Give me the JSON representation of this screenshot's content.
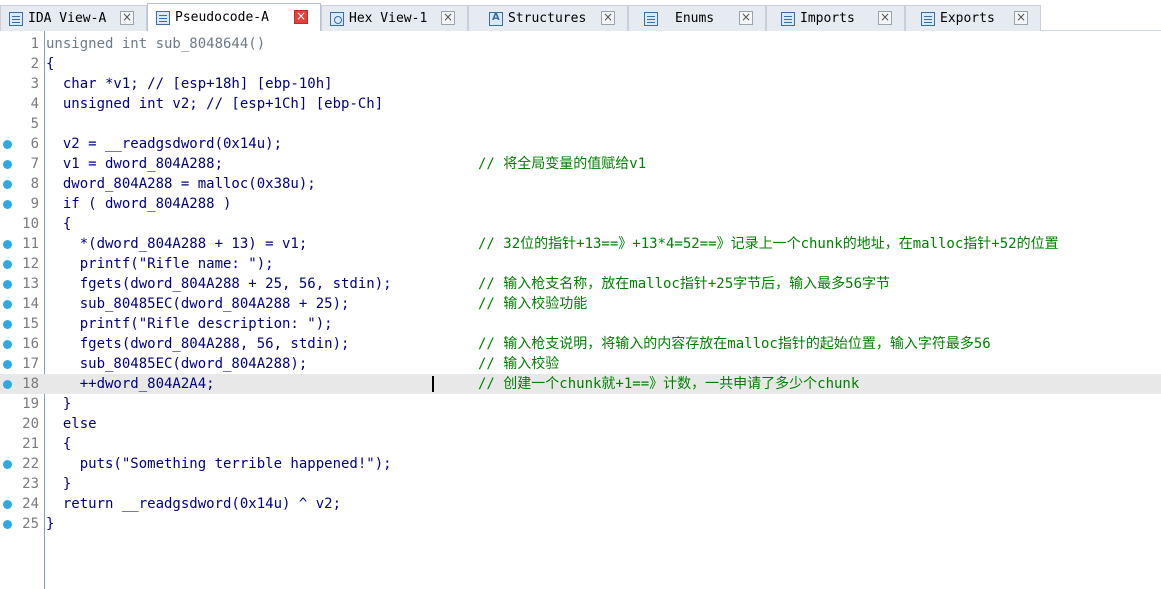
{
  "tabs": [
    {
      "label": "IDA View-A",
      "icon": "list-icon",
      "active": false
    },
    {
      "label": "Pseudocode-A",
      "icon": "pseudocode-icon",
      "active": true
    },
    {
      "label": "Hex View-1",
      "icon": "hex-icon",
      "active": false
    },
    {
      "label": "Structures",
      "icon": "structures-icon",
      "active": false
    },
    {
      "label": "Enums",
      "icon": "enums-icon",
      "active": false
    },
    {
      "label": "Imports",
      "icon": "imports-icon",
      "active": false
    },
    {
      "label": "Exports",
      "icon": "exports-icon",
      "active": false
    }
  ],
  "tab_close_glyph": "×",
  "code_lines": [
    {
      "num": "1",
      "code": "unsigned int sub_8048644()",
      "comment": "",
      "breakpoint": false,
      "dim": true
    },
    {
      "num": "2",
      "code": "{",
      "comment": "",
      "breakpoint": false
    },
    {
      "num": "3",
      "code": "  char *v1; // [esp+18h] [ebp-10h]",
      "comment": "",
      "breakpoint": false
    },
    {
      "num": "4",
      "code": "  unsigned int v2; // [esp+1Ch] [ebp-Ch]",
      "comment": "",
      "breakpoint": false
    },
    {
      "num": "5",
      "code": "",
      "comment": "",
      "breakpoint": false
    },
    {
      "num": "6",
      "code": "  v2 = __readgsdword(0x14u);",
      "comment": "",
      "breakpoint": true
    },
    {
      "num": "7",
      "code": "  v1 = dword_804A288;",
      "comment": "// 将全局变量的值赋给v1",
      "breakpoint": true
    },
    {
      "num": "8",
      "code": "  dword_804A288 = malloc(0x38u);",
      "comment": "",
      "breakpoint": true
    },
    {
      "num": "9",
      "code": "  if ( dword_804A288 )",
      "comment": "",
      "breakpoint": true
    },
    {
      "num": "10",
      "code": "  {",
      "comment": "",
      "breakpoint": false
    },
    {
      "num": "11",
      "code": "    *(dword_804A288 + 13) = v1;",
      "comment": "// 32位的指针+13==》+13*4=52==》记录上一个chunk的地址，在malloc指针+52的位置",
      "breakpoint": true
    },
    {
      "num": "12",
      "code": "    printf(\"Rifle name: \");",
      "comment": "",
      "breakpoint": true
    },
    {
      "num": "13",
      "code": "    fgets(dword_804A288 + 25, 56, stdin);",
      "comment": "// 输入枪支名称，放在malloc指针+25字节后，输入最多56字节",
      "breakpoint": true
    },
    {
      "num": "14",
      "code": "    sub_80485EC(dword_804A288 + 25);",
      "comment": "// 输入校验功能",
      "breakpoint": true
    },
    {
      "num": "15",
      "code": "    printf(\"Rifle description: \");",
      "comment": "",
      "breakpoint": true
    },
    {
      "num": "16",
      "code": "    fgets(dword_804A288, 56, stdin);",
      "comment": "// 输入枪支说明，将输入的内容存放在malloc指针的起始位置，输入字符最多56",
      "breakpoint": true
    },
    {
      "num": "17",
      "code": "    sub_80485EC(dword_804A288);",
      "comment": "// 输入校验",
      "breakpoint": true
    },
    {
      "num": "18",
      "code": "    ++dword_804A2A4;",
      "comment": "// 创建一个chunk就+1==》计数，一共申请了多少个chunk",
      "breakpoint": true,
      "current": true
    },
    {
      "num": "19",
      "code": "  }",
      "comment": "",
      "breakpoint": false
    },
    {
      "num": "20",
      "code": "  else",
      "comment": "",
      "breakpoint": false
    },
    {
      "num": "21",
      "code": "  {",
      "comment": "",
      "breakpoint": false
    },
    {
      "num": "22",
      "code": "    puts(\"Something terrible happened!\");",
      "comment": "",
      "breakpoint": true
    },
    {
      "num": "23",
      "code": "  }",
      "comment": "",
      "breakpoint": false
    },
    {
      "num": "24",
      "code": "  return __readgsdword(0x14u) ^ v2;",
      "comment": "",
      "breakpoint": true
    },
    {
      "num": "25",
      "code": "}",
      "comment": "",
      "breakpoint": true
    }
  ],
  "colors": {
    "code": "#000080",
    "comment": "#008000",
    "line_number": "#7a7a7a",
    "breakpoint": "#2fa8e8",
    "current_line_bg": "#e8e8e8",
    "active_tab_close": "#e4403a"
  }
}
